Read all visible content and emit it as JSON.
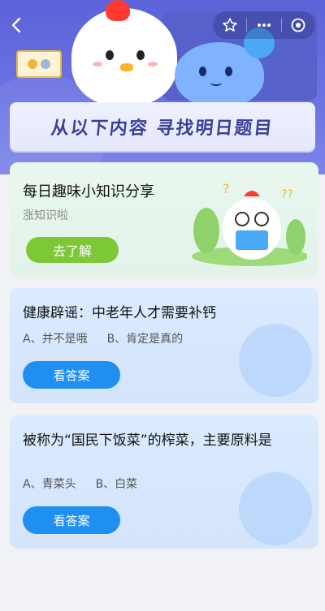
{
  "banner": {
    "title": "从以下内容 寻找明日题目"
  },
  "nav": {
    "back_icon": "back-arrow-icon",
    "star_icon": "star-icon",
    "more_icon": "more-icon",
    "target_icon": "target-icon"
  },
  "card_knowledge": {
    "title": "每日趣味小知识分享",
    "subtitle": "涨知识啦",
    "button_label": "去了解"
  },
  "questions": [
    {
      "title": "健康辟谣：中老年人才需要补钙",
      "option_a": "A、并不是哦",
      "option_b": "B、肯定是真的",
      "button_label": "看答案"
    },
    {
      "title": "被称为“国民下饭菜”的榨菜，主要原料是",
      "option_a": "A、青菜头",
      "option_b": "B、白菜",
      "button_label": "看答案"
    }
  ],
  "colors": {
    "hero": "#5b63d8",
    "green_button": "#7cc836",
    "blue_button": "#1f8ff2",
    "banner_text": "#3b3f9a"
  }
}
